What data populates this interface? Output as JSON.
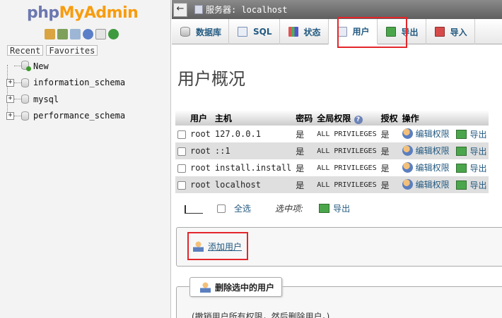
{
  "app": {
    "logo_part1": "php",
    "logo_part2": "MyAdmin",
    "quick_icons": [
      "home-icon",
      "exit-icon",
      "query-window-icon",
      "help-icon",
      "docs-icon",
      "reload-icon"
    ]
  },
  "nav": {
    "recent_label": "Recent",
    "favorites_label": "Favorites",
    "tree": [
      {
        "label": "New",
        "expander": ""
      },
      {
        "label": "information_schema",
        "expander": "+"
      },
      {
        "label": "mysql",
        "expander": "+"
      },
      {
        "label": "performance_schema",
        "expander": "+"
      }
    ]
  },
  "topbar": {
    "back_glyph": "←",
    "server_label": "服务器: localhost"
  },
  "menu": {
    "tabs": [
      {
        "label": "数据库",
        "icon": "database-icon"
      },
      {
        "label": "SQL",
        "icon": "sql-icon"
      },
      {
        "label": "状态",
        "icon": "status-icon"
      },
      {
        "label": "用户",
        "icon": "users-icon"
      },
      {
        "label": "导出",
        "icon": "export-icon"
      },
      {
        "label": "导入",
        "icon": "import-icon"
      }
    ]
  },
  "page": {
    "title": "用户概况"
  },
  "table": {
    "headers": {
      "user": "用户",
      "host": "主机",
      "password": "密码",
      "global_privileges": "全局权限",
      "grant": "授权",
      "action": "操作"
    },
    "edit_label": "编辑权限",
    "export_label": "导出",
    "rows": [
      {
        "user": "root",
        "host": "127.0.0.1",
        "password": "是",
        "privileges": "ALL PRIVILEGES",
        "grant": "是"
      },
      {
        "user": "root",
        "host": "::1",
        "password": "是",
        "privileges": "ALL PRIVILEGES",
        "grant": "是"
      },
      {
        "user": "root",
        "host": "install.install",
        "password": "是",
        "privileges": "ALL PRIVILEGES",
        "grant": "是"
      },
      {
        "user": "root",
        "host": "localhost",
        "password": "是",
        "privileges": "ALL PRIVILEGES",
        "grant": "是"
      }
    ]
  },
  "bulk": {
    "select_all": "全选",
    "with_selected": "选中项:",
    "export": "导出"
  },
  "add_user": {
    "label": "添加用户"
  },
  "delete": {
    "legend": "删除选中的用户",
    "note": "(撤销用户所有权限，然后删除用户。)"
  },
  "colors": {
    "highlight": "#e3262b",
    "link": "#235a81",
    "topbar": "#6f6f6f"
  }
}
